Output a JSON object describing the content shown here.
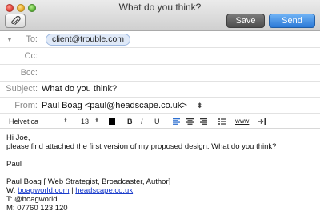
{
  "window": {
    "title": "What do you think?"
  },
  "toolbar": {
    "save_label": "Save",
    "send_label": "Send"
  },
  "header": {
    "to_label": "To:",
    "to_recipient": "client@trouble.com",
    "cc_label": "Cc:",
    "cc_value": "",
    "bcc_label": "Bcc:",
    "bcc_value": "",
    "subject_label": "Subject:",
    "subject_value": "What do you think?",
    "from_label": "From:",
    "from_value": "Paul Boag <paul@headscape.co.uk>"
  },
  "format_bar": {
    "font": "Helvetica",
    "size": "13",
    "bold": "B",
    "italic": "I",
    "underline": "U",
    "link": "www",
    "text_color": "#000000"
  },
  "body": {
    "greeting": "Hi Joe,",
    "paragraph": "please find attached the first version of my proposed design. What do you think?",
    "signoff": "Paul",
    "sig_name": "Paul Boag [ Web Strategist, Broadcaster, Author]",
    "sig_web_prefix": "W: ",
    "sig_web_1": "boagworld.com",
    "sig_web_sep": " | ",
    "sig_web_2": "headscape.co.uk",
    "sig_twitter": "T: @boagworld",
    "sig_mobile": "M: 07760 123 120"
  },
  "colors": {
    "send": "#2c79d6",
    "link": "#1a3ccb",
    "token": "#dfe9f8"
  }
}
